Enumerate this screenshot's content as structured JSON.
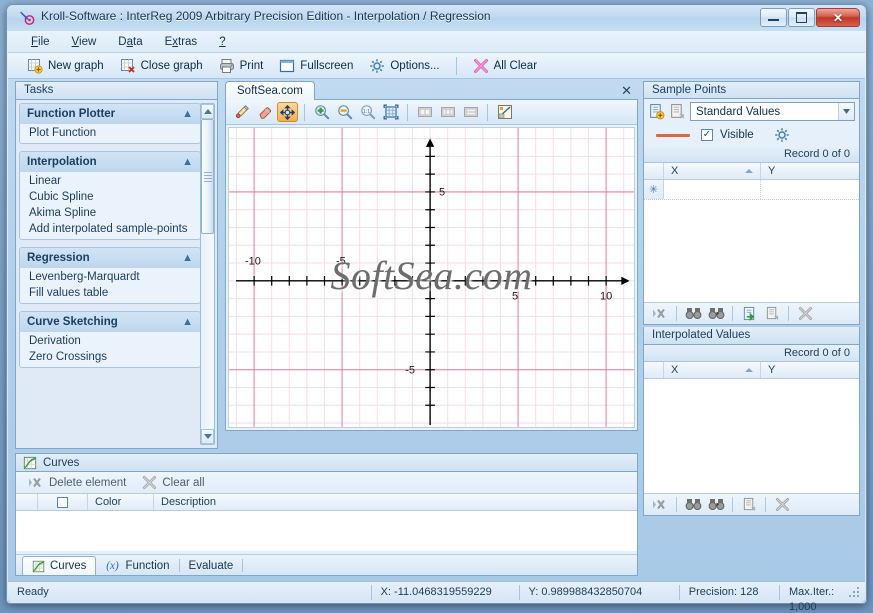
{
  "window": {
    "title": "Kroll-Software : InterReg 2009 Arbitrary Precision Edition - Interpolation / Regression",
    "app_icon": "pen-icon",
    "minimize_label": "Minimize",
    "maximize_label": "Maximize",
    "close_label": "✕"
  },
  "menu": [
    {
      "pre": "",
      "acc": "F",
      "post": "ile"
    },
    {
      "pre": "",
      "acc": "V",
      "post": "iew"
    },
    {
      "pre": "D",
      "acc": "a",
      "post": "ta"
    },
    {
      "pre": "E",
      "acc": "x",
      "post": "tras"
    },
    {
      "pre": "",
      "acc": "?",
      "post": ""
    }
  ],
  "toolbar": {
    "items": [
      {
        "label": "New graph",
        "icon": "new-graph-icon"
      },
      {
        "label": "Close graph",
        "icon": "close-graph-icon"
      },
      {
        "label": "Print",
        "icon": "printer-icon"
      },
      {
        "label": "Fullscreen",
        "icon": "fullscreen-icon"
      },
      {
        "label": "Options...",
        "icon": "gear-icon"
      }
    ],
    "all_clear": {
      "label": "All Clear",
      "icon": "clear-x-icon"
    }
  },
  "tasks": {
    "caption": "Tasks",
    "groups": [
      {
        "title": "Function Plotter",
        "items": [
          "Plot Function"
        ]
      },
      {
        "title": "Interpolation",
        "items": [
          "Linear",
          "Cubic Spline",
          "Akima Spline",
          "Add interpolated sample-points"
        ]
      },
      {
        "title": "Regression",
        "items": [
          "Levenberg-Marquardt",
          "Fill values table"
        ]
      },
      {
        "title": "Curve Sketching",
        "items": [
          "Derivation",
          "Zero Crossings"
        ]
      }
    ]
  },
  "graph": {
    "tab_label": "SoftSea.com",
    "close_label": "✕",
    "watermark": "SoftSea.com",
    "tools": [
      {
        "name": "draw-pen-icon",
        "active": false,
        "enabled": true
      },
      {
        "name": "eraser-icon",
        "active": false,
        "enabled": true
      },
      {
        "name": "pan-move-icon",
        "active": true,
        "enabled": true
      },
      {
        "name": "zoom-in-icon",
        "active": false,
        "enabled": true
      },
      {
        "name": "zoom-out-icon",
        "active": false,
        "enabled": true
      },
      {
        "name": "zoom-one-to-one-icon",
        "active": false,
        "enabled": true
      },
      {
        "name": "fit-to-window-icon",
        "active": false,
        "enabled": true
      },
      {
        "name": "layout-horizontal-icon",
        "active": false,
        "enabled": false
      },
      {
        "name": "layout-grid-icon",
        "active": false,
        "enabled": false
      },
      {
        "name": "layout-vertical-icon",
        "active": false,
        "enabled": false
      },
      {
        "name": "measure-chart-icon",
        "active": false,
        "enabled": true
      }
    ]
  },
  "chart_data": {
    "type": "line",
    "title": "",
    "xlabel": "",
    "ylabel": "",
    "xlim": [
      -11.7,
      11.0
    ],
    "ylim": [
      -8.0,
      8.1
    ],
    "xticks": [
      -10,
      -5,
      5,
      10
    ],
    "yticks": [
      5,
      -5
    ],
    "xtick_labels": [
      "-10",
      "-5",
      "5",
      "10"
    ],
    "ytick_labels": [
      "5",
      "-5"
    ],
    "minor_tick_step": 1,
    "major_grid_step": 5,
    "grid": true,
    "minor_grid_color": "#f6d9e1",
    "major_grid_color": "#e87fa0",
    "axis_color": "#000000",
    "background": "#ffffff",
    "series": [],
    "legend": "none",
    "annotations": [
      "SoftSea.com"
    ]
  },
  "sample_points": {
    "caption": "Sample Points",
    "new_icon": "new-table-icon",
    "copy_icon": "copy-table-icon",
    "dataset": "Standard Values",
    "color": "#e8603c",
    "visible_label": "Visible",
    "visible_checked": true,
    "settings_icon": "gear-icon",
    "record_status": "Record 0 of 0",
    "columns": [
      "X",
      "Y"
    ],
    "rows": [],
    "new_row_marker": "✳",
    "toolbar_icons": [
      "delete-row-icon",
      "find-icon",
      "find-next-icon",
      "import-icon",
      "export-icon",
      "clear-all-icon"
    ]
  },
  "interpolated_values": {
    "caption": "Interpolated Values",
    "record_status": "Record 0 of 0",
    "columns": [
      "X",
      "Y"
    ],
    "rows": [],
    "toolbar_icons": [
      "delete-row-icon",
      "find-icon",
      "find-next-icon",
      "export-icon",
      "clear-all-icon"
    ]
  },
  "curves": {
    "caption": "Curves",
    "caption_icon": "chart-icon",
    "delete_element": {
      "label": "Delete element",
      "icon": "delete-row-icon"
    },
    "clear_all": {
      "label": "Clear all",
      "icon": "clear-x-icon"
    },
    "columns": [
      "",
      "Color",
      "Description"
    ],
    "rows": [],
    "tabs": [
      {
        "label": "Curves",
        "icon": "chart-icon",
        "selected": true
      },
      {
        "label": "Function",
        "icon": "fx-icon",
        "selected": false
      },
      {
        "label": "Evaluate",
        "icon": "",
        "selected": false
      }
    ]
  },
  "statusbar": {
    "state": "Ready",
    "x": "X: -11.0468319559229",
    "y": "Y: 0.989988432850704",
    "precision": "Precision: 128",
    "max_iter": "Max.Iter.: 1,000"
  }
}
